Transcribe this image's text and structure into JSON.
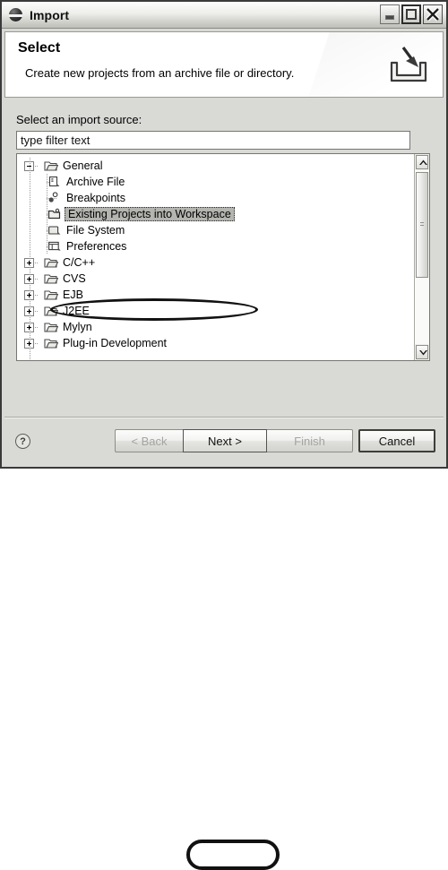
{
  "window": {
    "title": "Import",
    "app_icon": "eclipse-sphere-icon",
    "controls": {
      "minimize": "minimize-button",
      "maximize": "maximize-button",
      "close": "close-button"
    }
  },
  "header": {
    "title": "Select",
    "description": "Create new projects from an archive file or directory.",
    "icon": "import-arrow-icon"
  },
  "form": {
    "source_label": "Select an import source:",
    "filter": {
      "value": "type filter text",
      "placeholder": "type filter text"
    }
  },
  "tree": {
    "nodes": [
      {
        "label": "General",
        "level": 0,
        "expanded": true,
        "icon": "folder-open-icon",
        "selected": false
      },
      {
        "label": "Archive File",
        "level": 1,
        "icon": "archive-file-icon",
        "selected": false
      },
      {
        "label": "Breakpoints",
        "level": 1,
        "icon": "breakpoints-icon",
        "selected": false
      },
      {
        "label": "Existing Projects into Workspace",
        "level": 1,
        "icon": "existing-projects-icon",
        "selected": true
      },
      {
        "label": "File System",
        "level": 1,
        "icon": "file-system-icon",
        "selected": false
      },
      {
        "label": "Preferences",
        "level": 1,
        "icon": "preferences-icon",
        "selected": false
      },
      {
        "label": "C/C++",
        "level": 0,
        "expanded": false,
        "icon": "folder-closed-icon",
        "selected": false
      },
      {
        "label": "CVS",
        "level": 0,
        "expanded": false,
        "icon": "folder-closed-icon",
        "selected": false
      },
      {
        "label": "EJB",
        "level": 0,
        "expanded": false,
        "icon": "folder-closed-icon",
        "selected": false
      },
      {
        "label": "J2EE",
        "level": 0,
        "expanded": false,
        "icon": "folder-closed-icon",
        "selected": false
      },
      {
        "label": "Mylyn",
        "level": 0,
        "expanded": false,
        "icon": "folder-closed-icon",
        "selected": false
      },
      {
        "label": "Plug-in Development",
        "level": 0,
        "expanded": false,
        "icon": "folder-closed-icon",
        "selected": false
      }
    ],
    "scrollbar": {
      "up_arrow": "▲",
      "down_arrow": "▼",
      "thumb_position_percent": 0,
      "thumb_size_percent": 61
    }
  },
  "footer": {
    "help_label": "?",
    "buttons": [
      {
        "id": "back",
        "label": "< Back",
        "enabled": false,
        "highlighted": false
      },
      {
        "id": "next",
        "label": "Next >",
        "enabled": true,
        "highlighted": true
      },
      {
        "id": "finish",
        "label": "Finish",
        "enabled": false,
        "highlighted": false
      },
      {
        "id": "cancel",
        "label": "Cancel",
        "enabled": true,
        "highlighted": false
      }
    ]
  },
  "annotations": [
    {
      "target": "Existing Projects into Workspace",
      "shape": "ellipse"
    },
    {
      "target": "Next >",
      "shape": "ellipse"
    }
  ],
  "colors": {
    "dialog_bg": "#d9d9d6",
    "panel_bg": "#ffffff",
    "border": "#767672",
    "selection": "#b4b4b0",
    "text": "#000000",
    "disabled_text": "#a4a4a0"
  }
}
